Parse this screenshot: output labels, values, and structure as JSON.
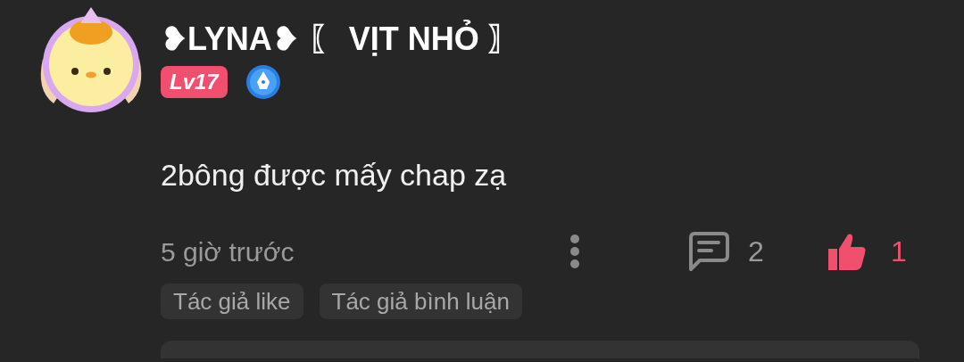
{
  "comment": {
    "author": "❥LYNA❥ 〖 VỊT NHỎ 〗",
    "level": "Lv17",
    "text": "2bông được mấy chap zạ",
    "time": "5 giờ trước",
    "reply_count": "2",
    "like_count": "1",
    "liked": true,
    "tags": [
      "Tác giả like",
      "Tác giả bình luận"
    ]
  }
}
